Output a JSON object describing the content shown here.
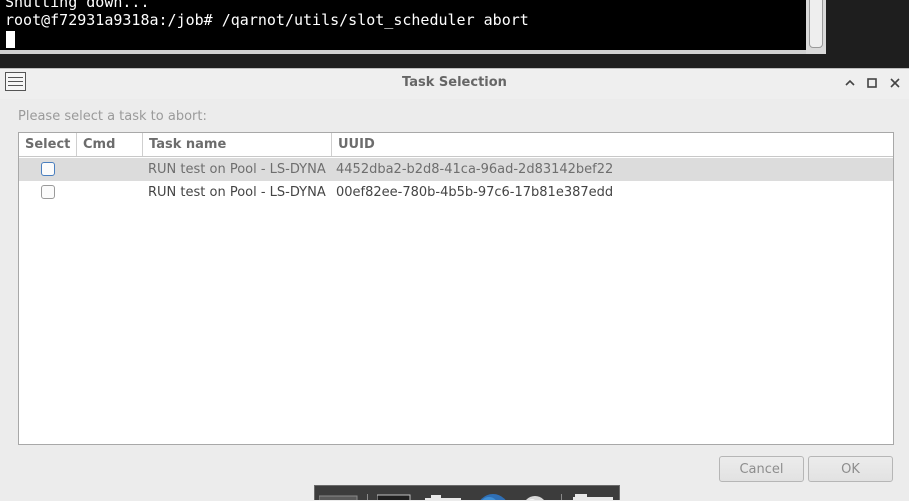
{
  "terminal": {
    "line_1": "Shutting down...",
    "line_2": "root@f72931a9318a:/job# /qarnot/utils/slot_scheduler abort"
  },
  "dialog": {
    "title": "Task Selection",
    "prompt": "Please select a task to abort:",
    "icons": {
      "app": "window-list-icon",
      "minimize": "chevron-up-icon",
      "maximize": "square-icon",
      "close": "close-icon"
    },
    "table": {
      "columns": [
        "Select",
        "Cmd",
        "Task name",
        "UUID"
      ],
      "rows": [
        {
          "selected": false,
          "cmd": "",
          "task_name": "RUN test on Pool - LS-DYNA",
          "uuid": "4452dba2-b2d8-41ca-96ad-2d83142bef22"
        },
        {
          "selected": false,
          "cmd": "",
          "task_name": "RUN test on Pool - LS-DYNA",
          "uuid": "00ef82ee-780b-4b5b-97c6-17b81e387edd"
        }
      ]
    },
    "buttons": {
      "cancel": "Cancel",
      "ok": "OK"
    }
  },
  "colors": {
    "terminal_bg": "#000000",
    "dialog_bg": "#ececec",
    "selected_row_bg": "#dcdcdc",
    "checkbox_focus": "#4a7fbf"
  }
}
